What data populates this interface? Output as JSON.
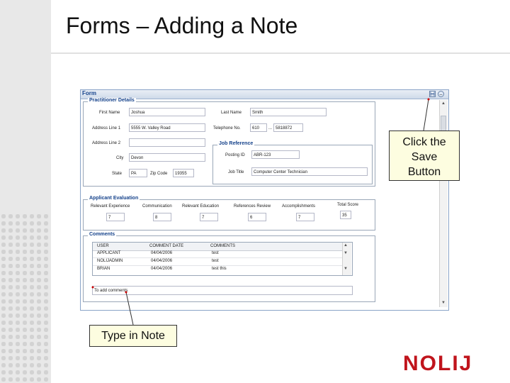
{
  "slide": {
    "title": "Forms – Adding a Note",
    "logo_text": "NOLIJ",
    "logo_color": "#c0141c"
  },
  "form": {
    "window_title": "Form",
    "header_buttons": [
      "save-icon",
      "collapse-icon"
    ],
    "practitioner": {
      "legend": "Practitioner Details",
      "first_name_label": "First Name",
      "first_name_value": "Joshua",
      "last_name_label": "Last Name",
      "last_name_value": "Smith",
      "address1_label": "Address Line 1",
      "address1_value": "5555 W. Valley Road",
      "telephone_label": "Telephone No.",
      "telephone_area": "610",
      "telephone_sep": "...",
      "telephone_value": "5818872",
      "address2_label": "Address Line 2",
      "address2_value": "",
      "city_label": "City",
      "city_value": "Devon",
      "state_label": "State",
      "state_value": "PA",
      "zip_label": "Zip Code",
      "zip_value": "19355"
    },
    "job_reference": {
      "legend": "Job Reference",
      "posting_label": "Posting ID",
      "posting_value": "ABR-123",
      "job_title_label": "Job Title",
      "job_title_value": "Computer Center Technician"
    },
    "evaluation": {
      "legend": "Applicant Evaluation",
      "columns": [
        {
          "label": "Relevant Experience",
          "value": "7"
        },
        {
          "label": "Communication",
          "value": "8"
        },
        {
          "label": "Relevant Education",
          "value": "7"
        },
        {
          "label": "References Review",
          "value": "6"
        },
        {
          "label": "Accomplishments",
          "value": "7"
        }
      ],
      "total_label": "Total Score",
      "total_value": "35"
    },
    "comments": {
      "legend": "Comments",
      "headers": [
        "USER",
        "COMMENT DATE",
        "COMMENTS"
      ],
      "rows": [
        [
          "APPLICANT",
          "04/04/2006",
          "test"
        ],
        [
          "NOLIJADMIN",
          "04/04/2006",
          "test"
        ],
        [
          "BRIAN",
          "04/04/2006",
          "test this"
        ]
      ],
      "input_value": "To add comments"
    }
  },
  "callouts": {
    "save_line1": "Click the",
    "save_line2": "Save",
    "save_line3": "Button",
    "note": "Type in Note"
  }
}
